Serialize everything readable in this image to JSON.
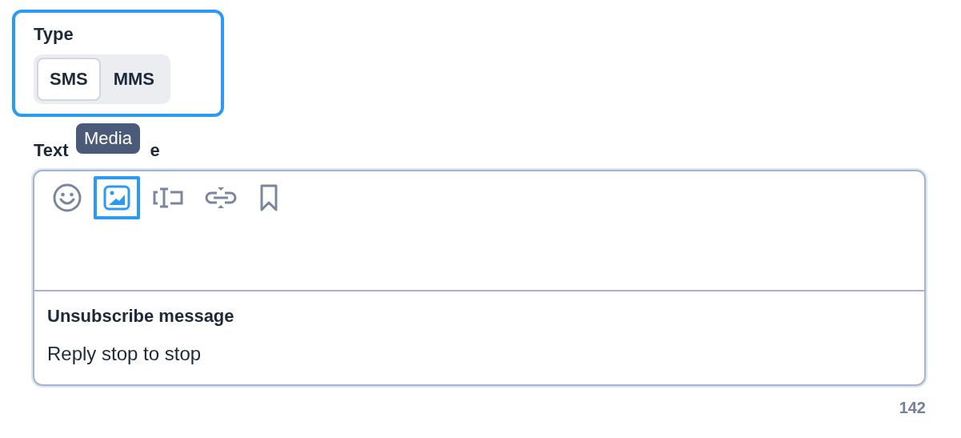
{
  "type_group": {
    "highlighted": true,
    "label": "Type",
    "options": [
      {
        "label": "SMS",
        "selected": true
      },
      {
        "label": "MMS",
        "selected": false
      }
    ]
  },
  "message": {
    "label_parts": [
      "Text",
      "e"
    ],
    "toolbar": [
      {
        "kind": "emoji",
        "highlighted": false
      },
      {
        "kind": "media",
        "highlighted": true,
        "tooltip": "Media"
      },
      {
        "kind": "variable",
        "highlighted": false
      },
      {
        "kind": "link",
        "highlighted": false
      },
      {
        "kind": "bookmark",
        "highlighted": false
      }
    ],
    "unsubscribe_title": "Unsubscribe message",
    "unsubscribe_text": "Reply stop to stop",
    "count": "142"
  }
}
